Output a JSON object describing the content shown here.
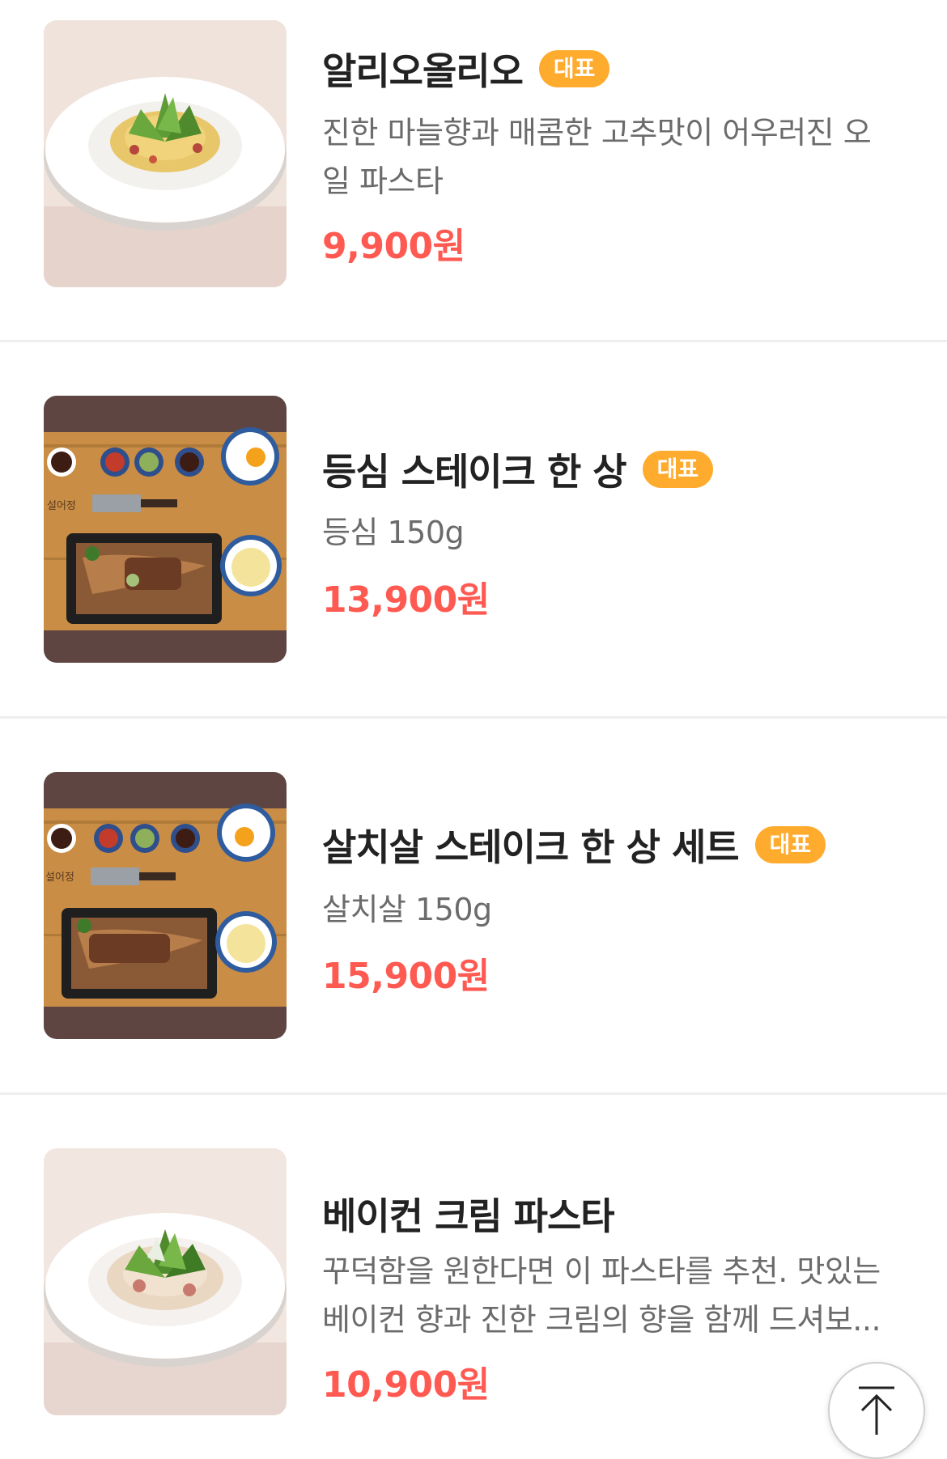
{
  "menu": {
    "items": [
      {
        "name": "알리오올리오",
        "badge": "대표",
        "description": "진한 마늘향과 매콤한 고추맛이 어우러진 오일 파스타",
        "price": "9,900원",
        "image_icon": "pasta-dish-image"
      },
      {
        "name": "등심 스테이크 한 상",
        "badge": "대표",
        "description": "등심 150g",
        "price": "13,900원",
        "image_icon": "steak-set-image",
        "board_text": "설어정"
      },
      {
        "name": "살치살 스테이크 한 상 세트",
        "badge": "대표",
        "description": "살치살 150g",
        "price": "15,900원",
        "image_icon": "steak-set-image",
        "board_text": "설어정"
      },
      {
        "name": "베이컨 크림 파스타",
        "description": "꾸덕함을 원한다면 이 파스타를 추천. 맛있는 베이컨 향과 진한 크림의 향을 함께 드셔보...",
        "price": "10,900원",
        "image_icon": "pasta-dish-image"
      }
    ]
  },
  "scroll_top_icon": "arrow-up-icon",
  "colors": {
    "price": "#ff5a52",
    "badge": "#ffab2e",
    "divider": "#eeeeee"
  }
}
